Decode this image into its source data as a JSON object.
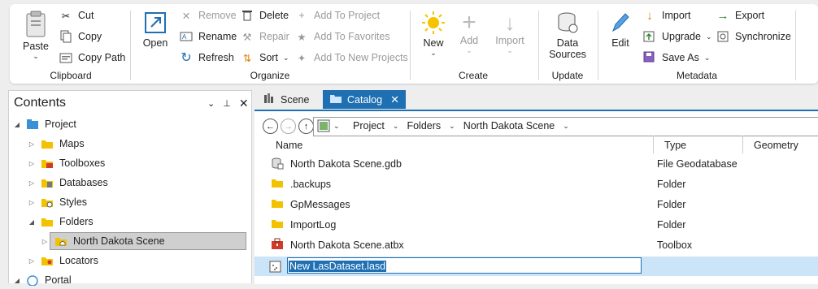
{
  "ribbon": {
    "clipboard": {
      "label": "Clipboard",
      "paste": "Paste",
      "cut": "Cut",
      "copy": "Copy",
      "copy_path": "Copy Path"
    },
    "organize": {
      "label": "Organize",
      "open": "Open",
      "remove": "Remove",
      "rename": "Rename",
      "refresh": "Refresh",
      "delete": "Delete",
      "repair": "Repair",
      "sort": "Sort",
      "add_to_project": "Add To Project",
      "add_to_favorites": "Add To Favorites",
      "add_to_new_projects": "Add To New Projects"
    },
    "create": {
      "label": "Create",
      "new": "New",
      "add": "Add",
      "import": "Import"
    },
    "update": {
      "label": "Update",
      "data_sources_line1": "Data",
      "data_sources_line2": "Sources"
    },
    "metadata": {
      "label": "Metadata",
      "edit": "Edit",
      "import": "Import",
      "upgrade": "Upgrade",
      "save_as": "Save As",
      "export": "Export",
      "synchronize": "Synchronize"
    }
  },
  "contents": {
    "title": "Contents",
    "items": [
      {
        "label": "Project",
        "icon": "project-icon"
      },
      {
        "label": "Maps",
        "icon": "folder-icon"
      },
      {
        "label": "Toolboxes",
        "icon": "toolbox-icon"
      },
      {
        "label": "Databases",
        "icon": "database-icon"
      },
      {
        "label": "Styles",
        "icon": "style-icon"
      },
      {
        "label": "Folders",
        "icon": "folder-icon"
      },
      {
        "label": "North Dakota Scene",
        "icon": "home-folder-icon"
      },
      {
        "label": "Locators",
        "icon": "locator-icon"
      },
      {
        "label": "Portal",
        "icon": "portal-icon"
      }
    ]
  },
  "tabs": [
    {
      "label": "Scene"
    },
    {
      "label": "Catalog"
    }
  ],
  "breadcrumb": [
    "Project",
    "Folders",
    "North Dakota Scene"
  ],
  "columns": [
    "Name",
    "Type",
    "Geometry"
  ],
  "files": [
    {
      "name": "North Dakota Scene.gdb",
      "type": "File Geodatabase"
    },
    {
      "name": ".backups",
      "type": "Folder"
    },
    {
      "name": "GpMessages",
      "type": "Folder"
    },
    {
      "name": "ImportLog",
      "type": "Folder"
    },
    {
      "name": "North Dakota Scene.atbx",
      "type": "Toolbox"
    }
  ],
  "new_item": {
    "value": "New LasDataset.lasd"
  },
  "colors": {
    "accent": "#1f6fb3",
    "folder": "#f2c200",
    "selection": "#cce4f7"
  }
}
